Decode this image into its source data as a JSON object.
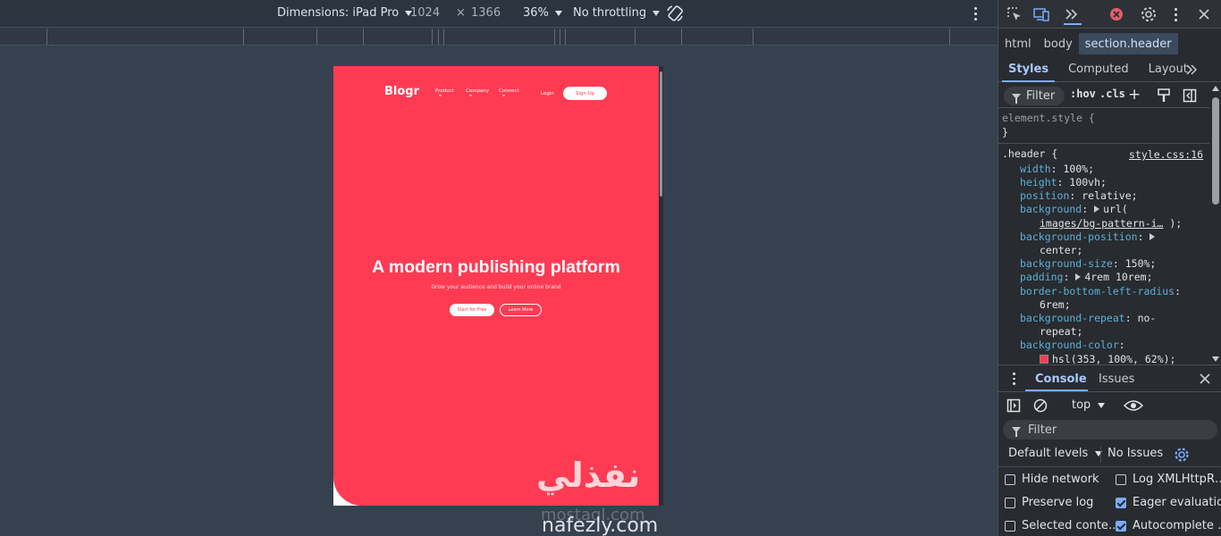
{
  "device_toolbar": {
    "dimensions_label": "Dimensions: iPad Pro",
    "width": "1024",
    "times": "×",
    "height": "1366",
    "zoom": "36%",
    "throttling": "No throttling"
  },
  "site": {
    "logo": "Blogr",
    "nav": [
      "Product",
      "Company",
      "Connect"
    ],
    "login": "Login",
    "signup": "Sign Up",
    "hero_title": "A modern publishing platform",
    "hero_subtitle": "Grow your audience and build your online brand",
    "cta_primary": "Start for Free",
    "cta_secondary": "Learn More",
    "brand_color": "#ff3b54"
  },
  "watermark": {
    "arabic": "نفذلي",
    "ghost": "mostaql.com",
    "url": "nafezly.com"
  },
  "devtools": {
    "breadcrumbs": [
      "html",
      "body",
      "section.header"
    ],
    "tabs": [
      "Styles",
      "Computed",
      "Layout"
    ],
    "filter_placeholder": "Filter",
    "hov": ":hov",
    "cls": ".cls",
    "element_style": "element.style {",
    "close_brace": "}",
    "rule_selector": ".header {",
    "rule_source": "style.css:16",
    "declarations": {
      "width_p": "width",
      "width_v": "100%;",
      "height_p": "height",
      "height_v": "100vh;",
      "position_p": "position",
      "position_v": "relative;",
      "bg_p": "background",
      "bg_v": "url(",
      "bg_url": "images/bg-pattern-i…",
      "bg_end": ");",
      "bgpos_p": "background-position",
      "bgpos_v": "center;",
      "bgsize_p": "background-size",
      "bgsize_v": "150%;",
      "padding_p": "padding",
      "padding_v": "4rem 10rem;",
      "radius_p": "border-bottom-left-radius",
      "radius_v": "6rem;",
      "repeat_p": "background-repeat",
      "repeat_v1": "no-",
      "repeat_v2": "repeat;",
      "bgcolor_p": "background-color",
      "bgcolor_v": "hsl(353, 100%, 62%);"
    },
    "drawer_tabs": [
      "Console",
      "Issues"
    ],
    "context": "top",
    "console_filter": "Filter",
    "default_levels": "Default levels",
    "no_issues": "No Issues",
    "options": [
      {
        "label": "Hide network",
        "checked": false
      },
      {
        "label": "Log XMLHttpR…",
        "checked": false
      },
      {
        "label": "Preserve log",
        "checked": false
      },
      {
        "label": "Eager evaluation",
        "checked": true
      },
      {
        "label": "Selected conte…",
        "checked": false
      },
      {
        "label": "Autocomplete …",
        "checked": true
      }
    ]
  }
}
